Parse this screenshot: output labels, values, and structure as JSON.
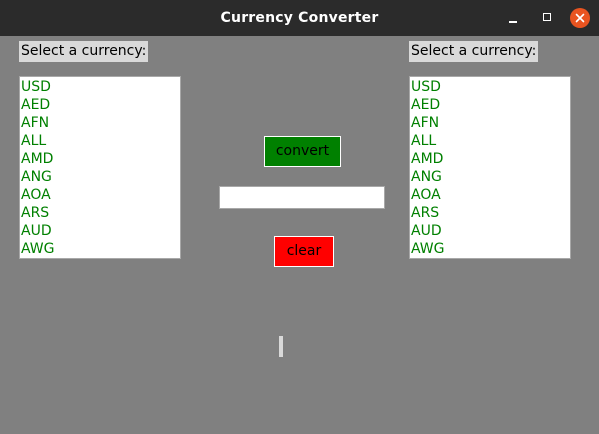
{
  "window": {
    "title": "Currency Converter"
  },
  "left_panel": {
    "label": "Select a currency:",
    "items": [
      "USD",
      "AED",
      "AFN",
      "ALL",
      "AMD",
      "ANG",
      "AOA",
      "ARS",
      "AUD",
      "AWG"
    ]
  },
  "right_panel": {
    "label": "Select a currency:",
    "items": [
      "USD",
      "AED",
      "AFN",
      "ALL",
      "AMD",
      "ANG",
      "AOA",
      "ARS",
      "AUD",
      "AWG"
    ]
  },
  "controls": {
    "convert_label": "convert",
    "clear_label": "clear",
    "amount_value": ""
  },
  "result": {
    "text": ""
  },
  "colors": {
    "background": "#808080",
    "titlebar": "#2b2b2b",
    "list_text": "#008000",
    "convert_button": "#008000",
    "clear_button": "#ff0000",
    "close_button": "#e95420",
    "label_bg": "#d9d9d9"
  },
  "icons": {
    "minimize": "minimize-icon",
    "maximize": "maximize-icon",
    "close": "close-icon"
  }
}
